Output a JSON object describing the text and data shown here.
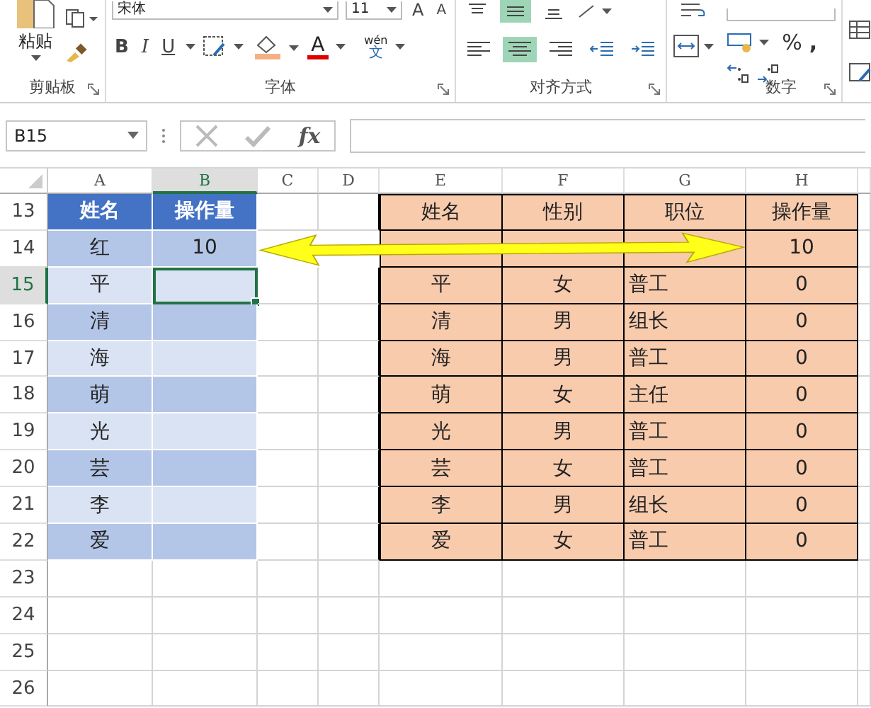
{
  "ribbon": {
    "clipboard": {
      "paste": "粘贴",
      "label": "剪贴板"
    },
    "font": {
      "name": "宋体",
      "size": "11",
      "grow": "A",
      "shrink": "A",
      "bold": "B",
      "italic": "I",
      "underline": "U",
      "font_color": "A",
      "phonetic_top": "wén",
      "phonetic_bottom": "文",
      "label": "字体"
    },
    "alignment": {
      "top_row": [
        {
          "kind": "top",
          "selected": false
        },
        {
          "kind": "middle",
          "selected": true
        },
        {
          "kind": "bottom",
          "selected": false
        }
      ],
      "bottom_row": [
        {
          "kind": "left",
          "selected": false
        },
        {
          "kind": "center",
          "selected": true
        },
        {
          "kind": "right",
          "selected": false
        },
        {
          "kind": "outdent",
          "selected": false
        },
        {
          "kind": "indent",
          "selected": false
        }
      ],
      "label": "对齐方式"
    },
    "number": {
      "percent": "%",
      "comma": ",",
      "label": "数字"
    }
  },
  "formula_bar": {
    "name_box": "B15",
    "fx": "fx"
  },
  "sheet": {
    "columns": [
      {
        "label": "A",
        "selected": false
      },
      {
        "label": "B",
        "selected": true
      },
      {
        "label": "C",
        "selected": false
      },
      {
        "label": "D",
        "selected": false
      },
      {
        "label": "E",
        "selected": false
      },
      {
        "label": "F",
        "selected": false
      },
      {
        "label": "G",
        "selected": false
      },
      {
        "label": "H",
        "selected": false
      }
    ],
    "rows": [
      {
        "number": "13",
        "selected": false,
        "cells": {
          "A": "姓名",
          "B": "操作量",
          "E": "姓名",
          "F": "性别",
          "G": "职位",
          "H": "操作量"
        }
      },
      {
        "number": "14",
        "selected": false,
        "cells": {
          "A": "红",
          "B": "10",
          "H": "10"
        }
      },
      {
        "number": "15",
        "selected": true,
        "cells": {
          "A": "平",
          "E": "平",
          "F": "女",
          "G": "普工",
          "H": "0"
        }
      },
      {
        "number": "16",
        "selected": false,
        "cells": {
          "A": "清",
          "E": "清",
          "F": "男",
          "G": "组长",
          "H": "0"
        }
      },
      {
        "number": "17",
        "selected": false,
        "cells": {
          "A": "海",
          "E": "海",
          "F": "男",
          "G": "普工",
          "H": "0"
        }
      },
      {
        "number": "18",
        "selected": false,
        "cells": {
          "A": "萌",
          "E": "萌",
          "F": "女",
          "G": "主任",
          "H": "0"
        }
      },
      {
        "number": "19",
        "selected": false,
        "cells": {
          "A": "光",
          "E": "光",
          "F": "男",
          "G": "普工",
          "H": "0"
        }
      },
      {
        "number": "20",
        "selected": false,
        "cells": {
          "A": "芸",
          "E": "芸",
          "F": "女",
          "G": "普工",
          "H": "0"
        }
      },
      {
        "number": "21",
        "selected": false,
        "cells": {
          "A": "李",
          "E": "李",
          "F": "男",
          "G": "组长",
          "H": "0"
        }
      },
      {
        "number": "22",
        "selected": false,
        "cells": {
          "A": "爱",
          "E": "爱",
          "F": "女",
          "G": "普工",
          "H": "0"
        }
      },
      {
        "number": "23",
        "selected": false,
        "cells": {}
      },
      {
        "number": "24",
        "selected": false,
        "cells": {}
      },
      {
        "number": "25",
        "selected": false,
        "cells": {}
      },
      {
        "number": "26",
        "selected": false,
        "cells": {}
      }
    ]
  }
}
